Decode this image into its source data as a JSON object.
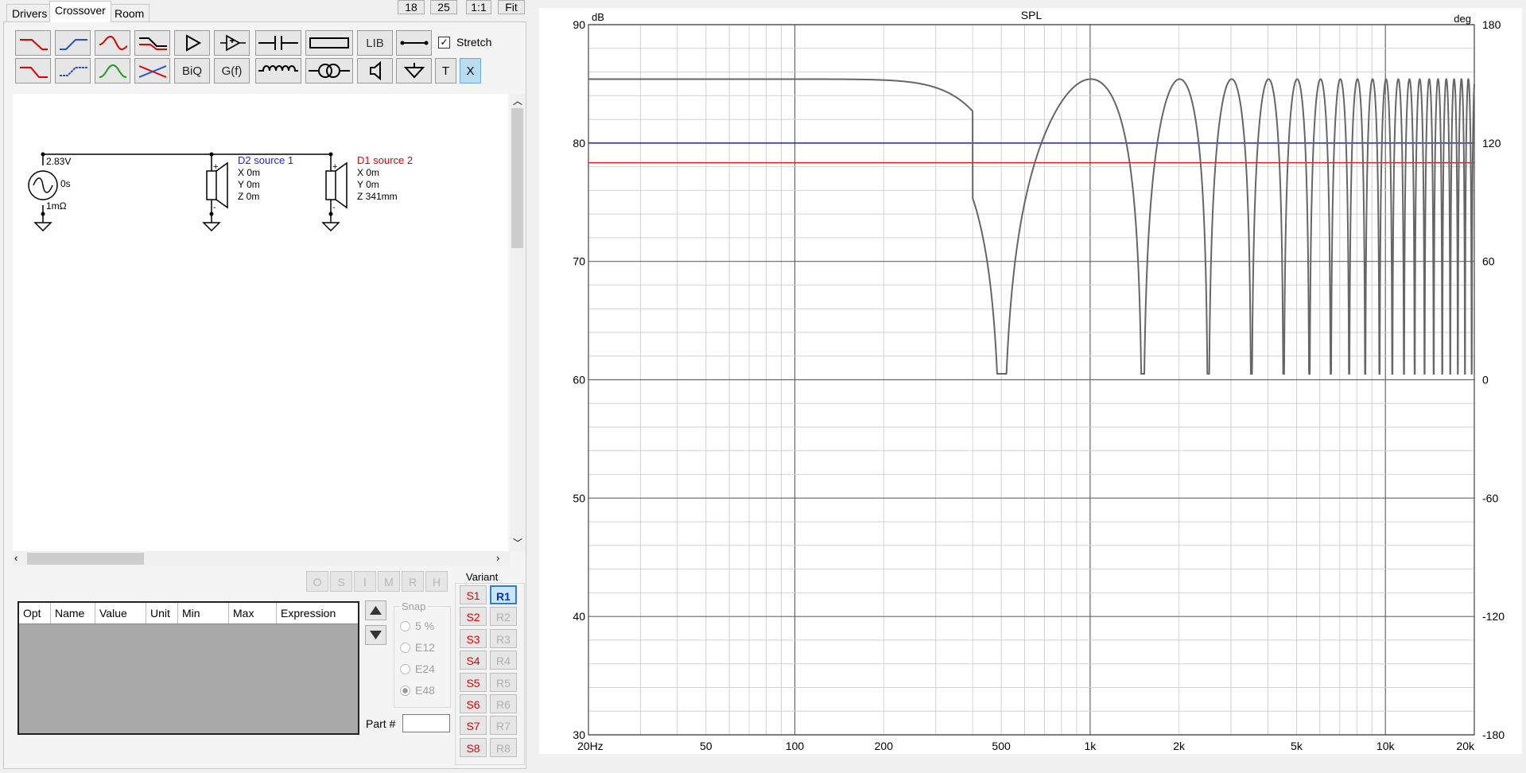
{
  "tabs": [
    {
      "label": "Drivers"
    },
    {
      "label": "Crossover"
    },
    {
      "label": "Room"
    }
  ],
  "top_buttons": {
    "b18": "18",
    "b25": "25",
    "b11": "1:1",
    "fit": "Fit"
  },
  "toolbar": {
    "lib": "LIB",
    "biq": "BiQ",
    "gf": "G(f)",
    "stretch": "Stretch",
    "stretch_checked": true,
    "t": "T",
    "x": "X"
  },
  "schematic": {
    "generator": {
      "voltage": "2.83V",
      "delay": "0s",
      "resistance": "1mΩ"
    },
    "drivers": [
      {
        "name": "D2 source 1",
        "x": "X 0m",
        "y": "Y 0m",
        "z": "Z 0m",
        "color": "#1f1fdf"
      },
      {
        "name": "D1 source 2",
        "x": "X 0m",
        "y": "Y 0m",
        "z": "Z 341mm",
        "color": "#e00000"
      }
    ]
  },
  "side_buttons": [
    "O",
    "S",
    "I",
    "M",
    "R",
    "H"
  ],
  "table": {
    "columns": [
      "Opt",
      "Name",
      "Value",
      "Unit",
      "Min",
      "Max",
      "Expression"
    ]
  },
  "snap": {
    "legend": "Snap",
    "options": [
      "5 %",
      "E12",
      "E24",
      "E48"
    ],
    "selected": "E48"
  },
  "part": {
    "label": "Part #",
    "value": ""
  },
  "variant": {
    "legend": "Variant",
    "s": [
      "S1",
      "S2",
      "S3",
      "S4",
      "S5",
      "S6",
      "S7",
      "S8"
    ],
    "r": [
      "R1",
      "R2",
      "R3",
      "R4",
      "R5",
      "R6",
      "R7",
      "R8"
    ],
    "active_r": "R1"
  },
  "chart_data": {
    "type": "line",
    "title": "SPL",
    "ylabel": "dB",
    "y2label": "deg",
    "xscale": "log",
    "xlim": [
      20,
      20000
    ],
    "ylim": [
      30,
      90
    ],
    "y2lim": [
      -180,
      180
    ],
    "x_ticks": [
      "20Hz",
      "50",
      "100",
      "200",
      "500",
      "1k",
      "2k",
      "5k",
      "10k",
      "20k"
    ],
    "y_ticks": [
      "90",
      "80",
      "70",
      "60",
      "50",
      "40",
      "30"
    ],
    "y2_ticks": [
      "180",
      "120",
      "60",
      "0",
      "-60",
      "-120",
      "-180"
    ],
    "grid": true,
    "series": [
      {
        "color": "#666666",
        "model": "comb",
        "base_db": 85.4,
        "lowpass_hz": 350,
        "delay_ms": 0.995,
        "points": [
          [
            20,
            85.4
          ],
          [
            100,
            84.9
          ],
          [
            200,
            83.3
          ],
          [
            300,
            80.7
          ],
          [
            500,
            61.6
          ],
          [
            1000,
            85.4
          ],
          [
            1500,
            61.0
          ],
          [
            2000,
            85.4
          ],
          [
            2500,
            60.7
          ],
          [
            3000,
            85.4
          ],
          [
            5000,
            85.6
          ],
          [
            10000,
            85.5
          ],
          [
            20000,
            85.7
          ]
        ]
      },
      {
        "color": "#2020dd",
        "values_deg": [
          120,
          120
        ]
      },
      {
        "color": "#e02020",
        "values_deg": [
          110,
          110
        ]
      }
    ]
  }
}
